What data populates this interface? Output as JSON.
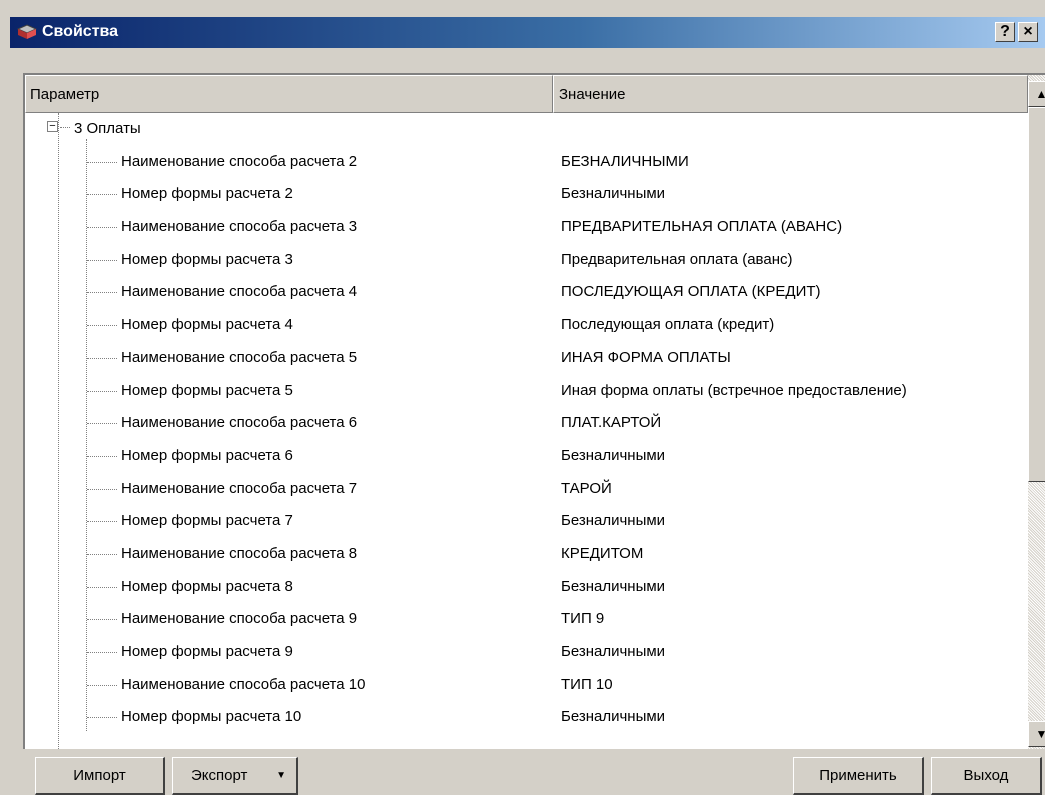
{
  "window": {
    "title": "Свойства",
    "help_label": "?",
    "close_label": "×"
  },
  "grid": {
    "columns": {
      "param": "Параметр",
      "value": "Значение"
    },
    "group": {
      "expander": "−",
      "label": "3 Оплаты"
    },
    "rows": [
      {
        "param": "Наименование способа расчета 2",
        "value": "БЕЗНАЛИЧНЫМИ"
      },
      {
        "param": "Номер формы расчета 2",
        "value": "Безналичными"
      },
      {
        "param": "Наименование способа расчета 3",
        "value": "ПРЕДВАРИТЕЛЬНАЯ ОПЛАТА (АВАНС)"
      },
      {
        "param": "Номер формы расчета 3",
        "value": "Предварительная оплата (аванс)"
      },
      {
        "param": "Наименование способа расчета 4",
        "value": "ПОСЛЕДУЮЩАЯ ОПЛАТА (КРЕДИТ)"
      },
      {
        "param": "Номер формы расчета 4",
        "value": "Последующая оплата (кредит)"
      },
      {
        "param": "Наименование способа расчета 5",
        "value": "ИНАЯ ФОРМА ОПЛАТЫ"
      },
      {
        "param": "Номер формы расчета 5",
        "value": "Иная форма оплаты (встречное предоставление)"
      },
      {
        "param": "Наименование способа расчета 6",
        "value": "ПЛАТ.КАРТОЙ"
      },
      {
        "param": "Номер формы расчета 6",
        "value": "Безналичными"
      },
      {
        "param": "Наименование способа расчета 7",
        "value": "ТАРОЙ"
      },
      {
        "param": "Номер формы расчета 7",
        "value": "Безналичными"
      },
      {
        "param": "Наименование способа расчета 8",
        "value": "КРЕДИТОМ"
      },
      {
        "param": "Номер формы расчета 8",
        "value": "Безналичными"
      },
      {
        "param": "Наименование способа расчета 9",
        "value": "ТИП 9"
      },
      {
        "param": "Номер формы расчета 9",
        "value": "Безналичными"
      },
      {
        "param": "Наименование способа расчета 10",
        "value": "ТИП 10"
      },
      {
        "param": "Номер формы расчета 10",
        "value": "Безналичными"
      }
    ]
  },
  "scrollbar": {
    "up_label": "▲",
    "down_label": "▼"
  },
  "buttons": {
    "import": "Импорт",
    "export": "Экспорт",
    "export_caret": "▼",
    "apply": "Применить",
    "exit": "Выход"
  },
  "colors": {
    "title_start": "#0a246a",
    "title_end": "#a6caf0",
    "face": "#d4d0c8"
  }
}
